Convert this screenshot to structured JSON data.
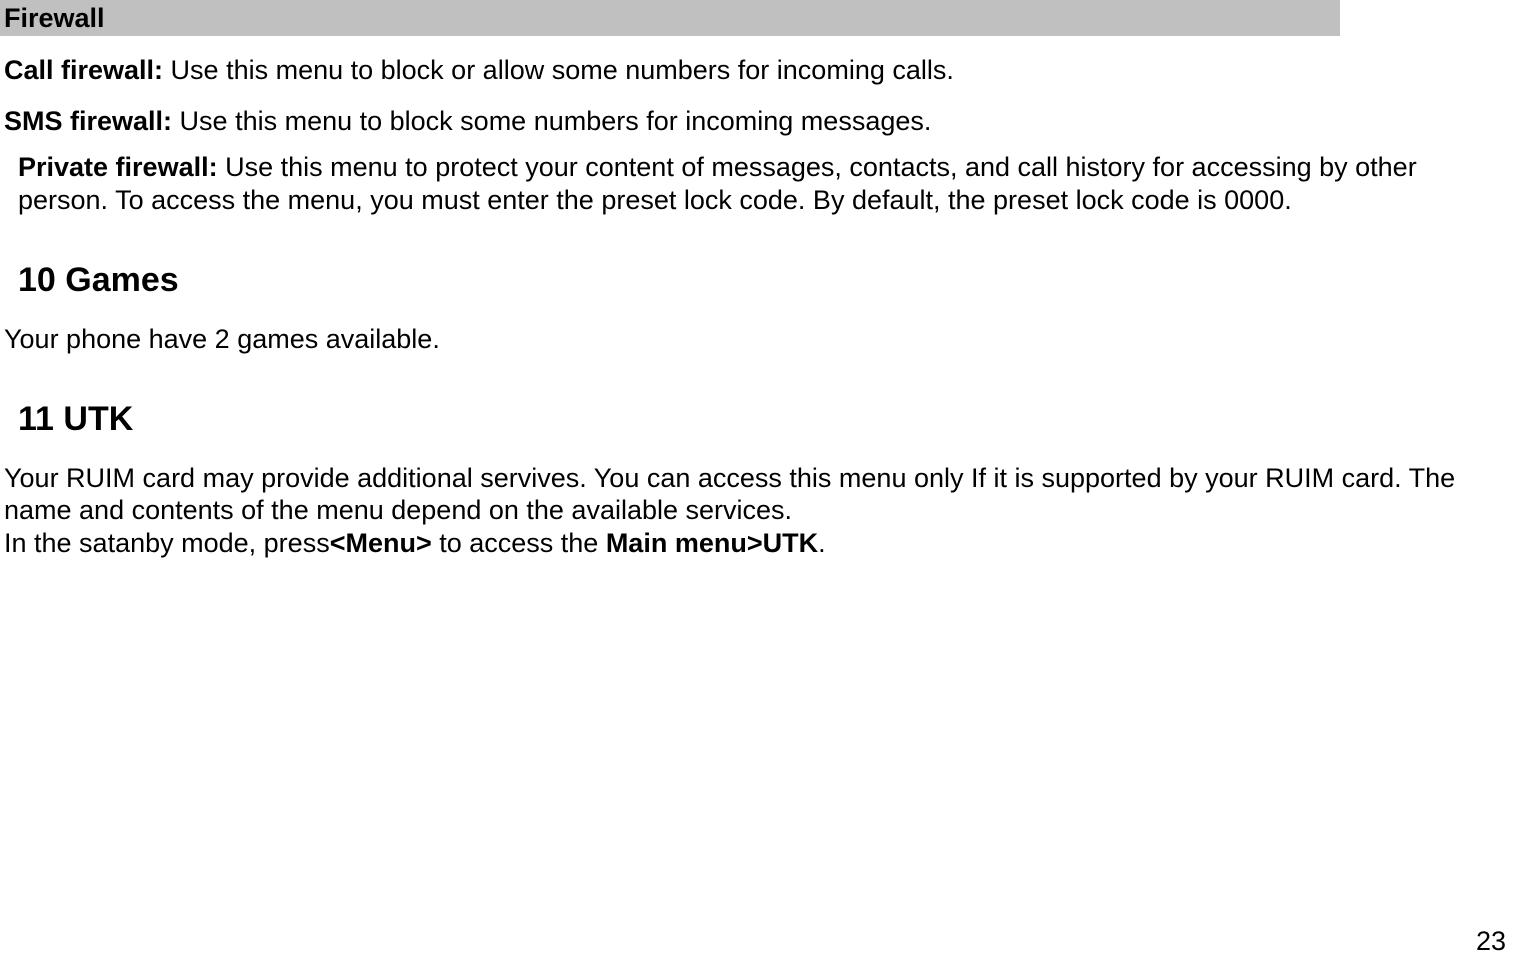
{
  "firewall": {
    "header": "Firewall",
    "call_label": "Call firewall:",
    "call_text": " Use this menu to block or allow some numbers for incoming calls.",
    "sms_label": "SMS firewall:",
    "sms_text": " Use this menu to block some numbers for incoming messages.",
    "private_label": "Private firewall:",
    "private_text": " Use this menu to protect your content of messages, contacts, and call history for accessing by other person. To access the menu, you must enter the preset lock code. By default, the preset lock code is 0000."
  },
  "games": {
    "heading": "10 Games",
    "text": "Your phone have 2 games available."
  },
  "utk": {
    "heading": "11 UTK",
    "text1": "Your RUIM card may provide additional servives. You can access this menu only If it is supported by your RUIM card. The name and contents of the menu depend on the available services.",
    "text2_prefix": "In the satanby mode, press",
    "text2_bold1": "<Menu>",
    "text2_mid": " to access the ",
    "text2_bold2": "Main menu>UTK",
    "text2_suffix": "."
  },
  "page_number": "23"
}
